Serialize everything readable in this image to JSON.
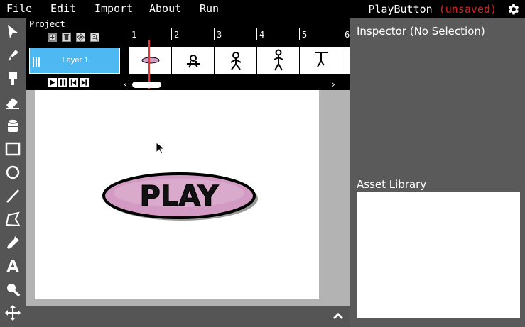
{
  "menu": {
    "file": "File",
    "edit": "Edit",
    "import": "Import",
    "about": "About",
    "run": "Run"
  },
  "title": {
    "name": "PlayButton",
    "status": "(unsaved)"
  },
  "timeline": {
    "project_label": "Project",
    "layer_name": "Layer 1",
    "frame_numbers": [
      "1",
      "2",
      "3",
      "4",
      "5",
      "6"
    ]
  },
  "stage": {
    "button_text": "PLAY"
  },
  "inspector": {
    "title": "Inspector (No Selection)"
  },
  "asset_library": {
    "title": "Asset Library"
  },
  "colors": {
    "layer_selected": "#4eb8f3",
    "button_fill": "#d39bc3",
    "playhead": "#ee3333",
    "unsaved": "#e02020"
  },
  "icons": {
    "tools": [
      "cursor-icon",
      "pen-icon",
      "brush-icon",
      "eraser-icon",
      "fill-bucket-icon",
      "rectangle-icon",
      "ellipse-icon",
      "line-icon",
      "lasso-icon",
      "eyedropper-icon",
      "text-icon",
      "zoom-icon",
      "pan-icon"
    ],
    "settings": "gear-icon",
    "collapse": "chevron-up-icon"
  }
}
